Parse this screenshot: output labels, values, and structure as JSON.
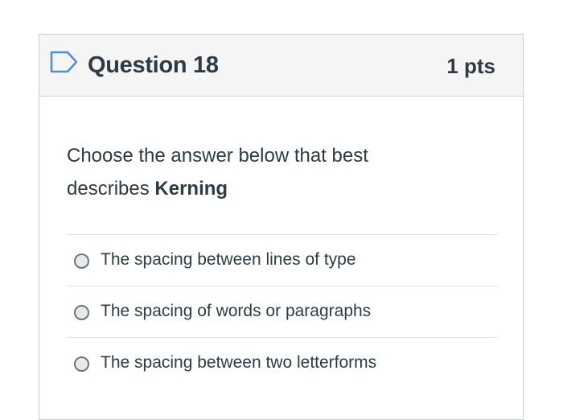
{
  "question": {
    "title": "Question 18",
    "points": "1 pts",
    "flag_icon": "bookmark-flag-icon",
    "prompt_prefix": "Choose the answer below that best describes ",
    "prompt_bold": "Kerning"
  },
  "answers": [
    {
      "label": "The spacing between lines of type",
      "selected": false
    },
    {
      "label": "The spacing of words or paragraphs",
      "selected": false
    },
    {
      "label": "The spacing between two letterforms",
      "selected": false
    }
  ],
  "colors": {
    "header_bg": "#f5f5f5",
    "border": "#c7cdd1",
    "text": "#2d3b45",
    "flag": "#4a8fd8"
  }
}
